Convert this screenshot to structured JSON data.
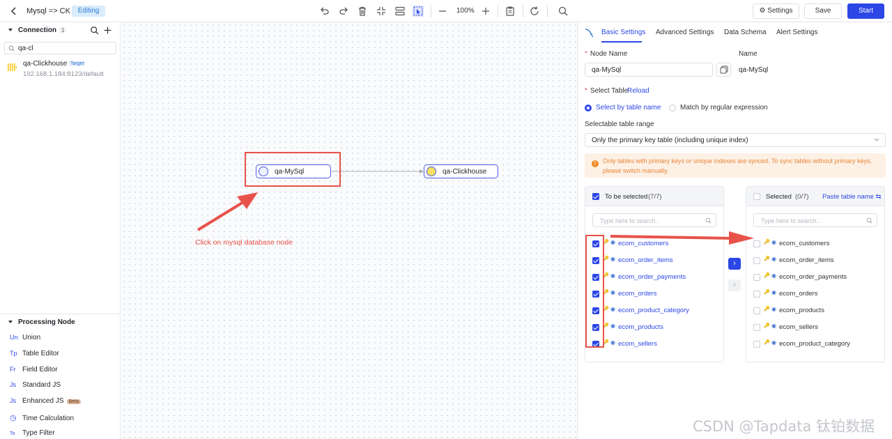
{
  "topbar": {
    "title": "Mysql => CK",
    "status_badge": "Editing",
    "zoom": "100%",
    "settings_label": "Settings",
    "save_label": "Save",
    "start_label": "Start"
  },
  "connection": {
    "header": "Connection",
    "count": "1",
    "search_value": "qa-cl",
    "item": {
      "name": "qa-Clickhouse",
      "tag": "Target",
      "address": "192.168.1.184:8123/default"
    }
  },
  "processing": {
    "header": "Processing Node",
    "items": [
      {
        "abbr": "Un",
        "label": "Union"
      },
      {
        "abbr": "Tp",
        "label": "Table Editor"
      },
      {
        "abbr": "Fr",
        "label": "Field Editor"
      },
      {
        "abbr": "Js",
        "label": "Standard JS"
      },
      {
        "abbr": "Js",
        "label": "Enhanced JS",
        "badge": "Beta"
      },
      {
        "abbr": "◷",
        "label": "Time Calculation"
      },
      {
        "abbr": "To",
        "label": "Type Filter"
      }
    ]
  },
  "canvas": {
    "source_node": "qa-MySql",
    "target_node": "qa-Clickhouse",
    "annotation": "Click on mysql database node"
  },
  "panel": {
    "tabs": [
      "Basic Settings",
      "Advanced Settings",
      "Data Schema",
      "Alert Settings"
    ],
    "node_name_label": "Node Name",
    "node_name_value": "qa-MySql",
    "name_label": "Name",
    "name_value": "qa-MySql",
    "select_table_label": "Select Table",
    "reload_label": "Reload",
    "radio_by_name": "Select by table name",
    "radio_regex": "Match by regular expression",
    "range_label": "Selectable table range",
    "range_value": "Only the primary key table (including unique index)",
    "warning": "Only tables with primary keys or unique indexes are synced. To sync tables without primary keys, please switch manually.",
    "left_box": {
      "title": "To be selected",
      "count": "(7/7)",
      "search_placeholder": "Type here to search..",
      "tables": [
        "ecom_customers",
        "ecom_order_items",
        "ecom_order_payments",
        "ecom_orders",
        "ecom_product_category",
        "ecom_products",
        "ecom_sellers"
      ]
    },
    "right_box": {
      "title": "Selected",
      "count": "(0/7)",
      "paste_label": "Paste table name",
      "search_placeholder": "Type here to search..",
      "tables": [
        "ecom_customers",
        "ecom_order_items",
        "ecom_order_payments",
        "ecom_orders",
        "ecom_products",
        "ecom_sellers",
        "ecom_product_category"
      ]
    }
  },
  "watermark": "CSDN @Tapdata 钛铂数据",
  "colors": {
    "accent": "#2c47e6",
    "annotation": "#e8524a",
    "warning": "#e8863a"
  }
}
